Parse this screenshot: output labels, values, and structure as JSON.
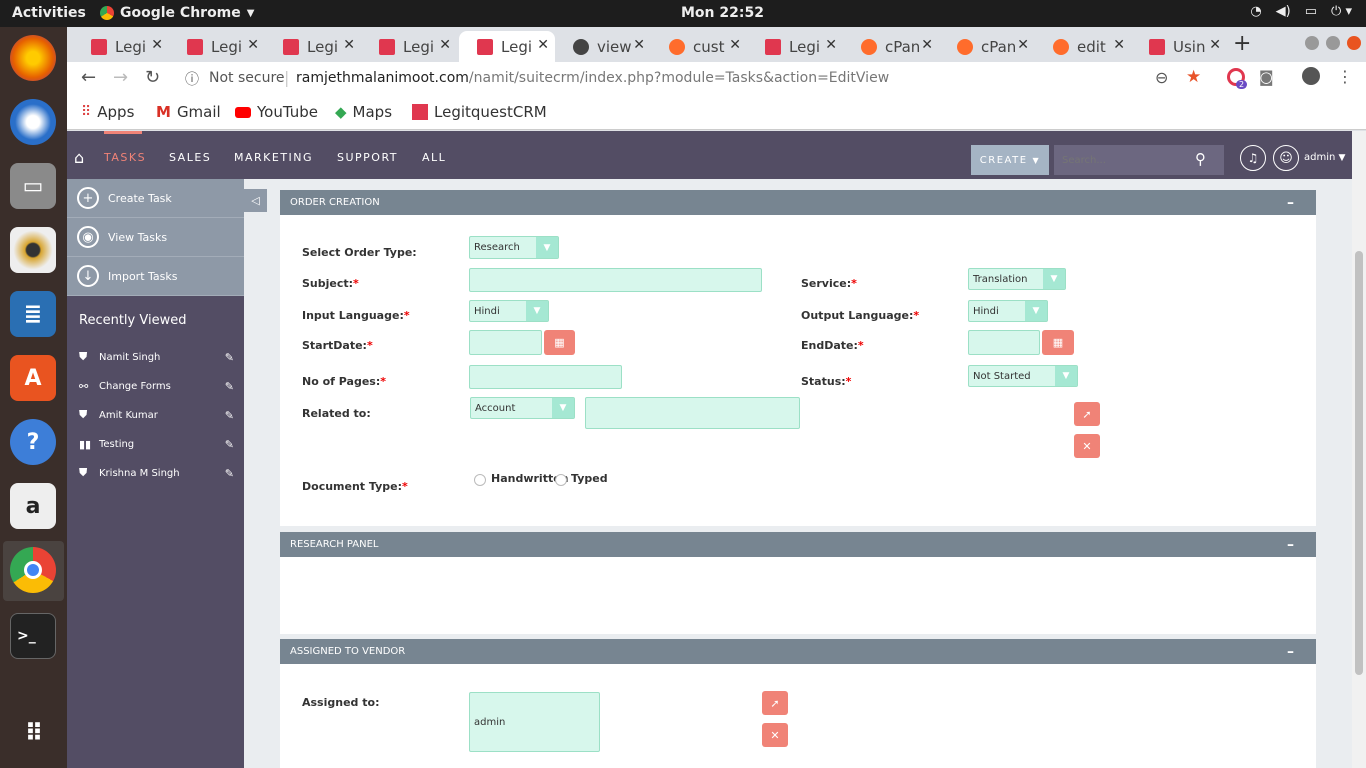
{
  "os": {
    "activities": "Activities",
    "app_menu": "Google Chrome",
    "clock": "Mon 22:52"
  },
  "dock": [
    {
      "name": "firefox-icon",
      "color": "#e66000"
    },
    {
      "name": "thunderbird-icon",
      "color": "#2a6fc9"
    },
    {
      "name": "files-icon",
      "color": "#8a8a8a"
    },
    {
      "name": "rhythmbox-icon",
      "color": "#d8a530"
    },
    {
      "name": "libreoffice-writer-icon",
      "color": "#2a6fb3"
    },
    {
      "name": "software-center-icon",
      "color": "#e95420"
    },
    {
      "name": "help-icon",
      "color": "#3d7ed8"
    },
    {
      "name": "amazon-icon",
      "color": "#eeeeee"
    },
    {
      "name": "chrome-icon",
      "color": "#34a853"
    },
    {
      "name": "terminal-icon",
      "color": "#222222"
    },
    {
      "name": "show-apps-icon",
      "color": "#3a2e2a"
    }
  ],
  "browser": {
    "tabs": [
      {
        "label": "Legi",
        "fav": "#e0374f"
      },
      {
        "label": "Legi",
        "fav": "#e0374f"
      },
      {
        "label": "Legi",
        "fav": "#e0374f"
      },
      {
        "label": "Legi",
        "fav": "#e0374f"
      },
      {
        "label": "Legi",
        "fav": "#e0374f"
      },
      {
        "label": "view",
        "fav": "#444444"
      },
      {
        "label": "cust",
        "fav": "#ff6c2c"
      },
      {
        "label": "Legi",
        "fav": "#e0374f"
      },
      {
        "label": "cPan",
        "fav": "#ff6c2c"
      },
      {
        "label": "cPan",
        "fav": "#ff6c2c"
      },
      {
        "label": "edit",
        "fav": "#ff6c2c"
      },
      {
        "label": "Usin",
        "fav": "#e0374f"
      }
    ],
    "security": "Not secure",
    "url_host": "ramjethmalanimoot.com",
    "url_path": "/namit/suitecrm/index.php?module=Tasks&action=EditView",
    "extension_badge": "2",
    "bookmarks": [
      "Apps",
      "Gmail",
      "YouTube",
      "Maps",
      "LegitquestCRM"
    ]
  },
  "crm": {
    "nav": [
      "TASKS",
      "SALES",
      "MARKETING",
      "SUPPORT",
      "ALL"
    ],
    "create_label": "CREATE",
    "search_placeholder": "Search...",
    "user": "admin",
    "actions": [
      "Create Task",
      "View Tasks",
      "Import Tasks"
    ],
    "recently_viewed_title": "Recently Viewed",
    "recently_viewed": [
      "Namit Singh",
      "Change Forms",
      "Amit Kumar",
      "Testing",
      "Krishna M Singh"
    ],
    "panels": {
      "order_creation": "ORDER CREATION",
      "research_panel": "RESEARCH PANEL",
      "assigned_vendor": "ASSIGNED TO VENDOR"
    },
    "form": {
      "order_type_label": "Select Order Type:",
      "order_type_value": "Research",
      "subject_label": "Subject:",
      "service_label": "Service:",
      "service_value": "Translation",
      "input_lang_label": "Input Language:",
      "input_lang_value": "Hindi",
      "output_lang_label": "Output Language:",
      "output_lang_value": "Hindi",
      "start_date_label": "StartDate:",
      "end_date_label": "EndDate:",
      "pages_label": "No of Pages:",
      "status_label": "Status:",
      "status_value": "Not Started",
      "related_label": "Related to:",
      "related_value": "Account",
      "doc_type_label": "Document Type:",
      "doc_opt1": "Handwritten",
      "doc_opt2": "Typed",
      "assigned_label": "Assigned to:",
      "assigned_value": "admin"
    }
  }
}
